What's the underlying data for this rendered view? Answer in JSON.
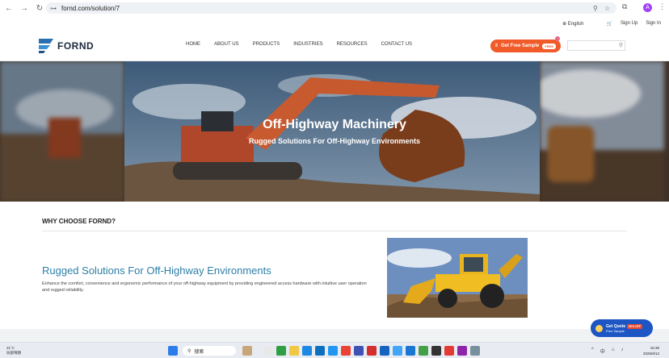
{
  "browser": {
    "url": "fornd.com/solution/7",
    "avatar_letter": "A"
  },
  "topbar": {
    "language": "English",
    "signup": "Sign Up",
    "signin": "Sign In"
  },
  "header": {
    "logo_text": "FORND",
    "nav": [
      "HOME",
      "ABOUT US",
      "PRODUCTS",
      "INDUSTRIES",
      "RESOURCES",
      "CONTACT US"
    ],
    "sample_button": "Get Free Sample",
    "sample_tag": "FREE"
  },
  "hero": {
    "title": "Off-Highway Machinery",
    "subtitle": "Rugged Solutions For Off-Highway Environments"
  },
  "why": {
    "heading": "WHY CHOOSE FORND?"
  },
  "section": {
    "title": "Rugged Solutions For Off-Highway Environments",
    "text": "Enhance the comfort, convenience and ergonomic performance of your off-highway equipment by providing engineered access hardware with intuitive user operation and rugged reliability."
  },
  "quote_widget": {
    "title": "Get Quote",
    "badge": "90% OFF",
    "sub": "Free Sample"
  },
  "taskbar": {
    "weather_temp": "31°C",
    "weather_desc": "局部晴朗",
    "search_placeholder": "搜索",
    "ime": "中",
    "time": "15:36",
    "date": "2025/9/12"
  },
  "colors": {
    "accent_orange": "#f15a29",
    "link_blue": "#2e7fa6",
    "quote_blue": "#1d56c4"
  }
}
